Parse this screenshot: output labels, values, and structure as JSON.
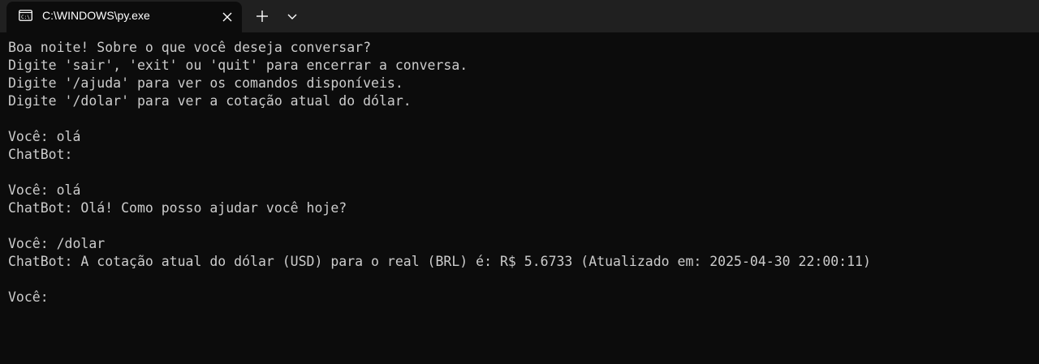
{
  "tab": {
    "title": "C:\\WINDOWS\\py.exe",
    "icon": "terminal-icon"
  },
  "toolbar": {
    "new_tab_icon": "plus-icon",
    "dropdown_icon": "chevron-down-icon",
    "close_icon": "close-icon"
  },
  "console": {
    "lines": [
      "Boa noite! Sobre o que você deseja conversar?",
      "Digite 'sair', 'exit' ou 'quit' para encerrar a conversa.",
      "Digite '/ajuda' para ver os comandos disponíveis.",
      "Digite '/dolar' para ver a cotação atual do dólar.",
      "",
      "Você: olá",
      "ChatBot:",
      "",
      "Você: olá",
      "ChatBot: Olá! Como posso ajudar você hoje?",
      "",
      "Você: /dolar",
      "ChatBot: A cotação atual do dólar (USD) para o real (BRL) é: R$ 5.6733 (Atualizado em: 2025-04-30 22:00:11)",
      "",
      "Você:"
    ]
  },
  "colors": {
    "background": "#0c0c0c",
    "tabbar": "#202020",
    "text": "#cccccc"
  }
}
